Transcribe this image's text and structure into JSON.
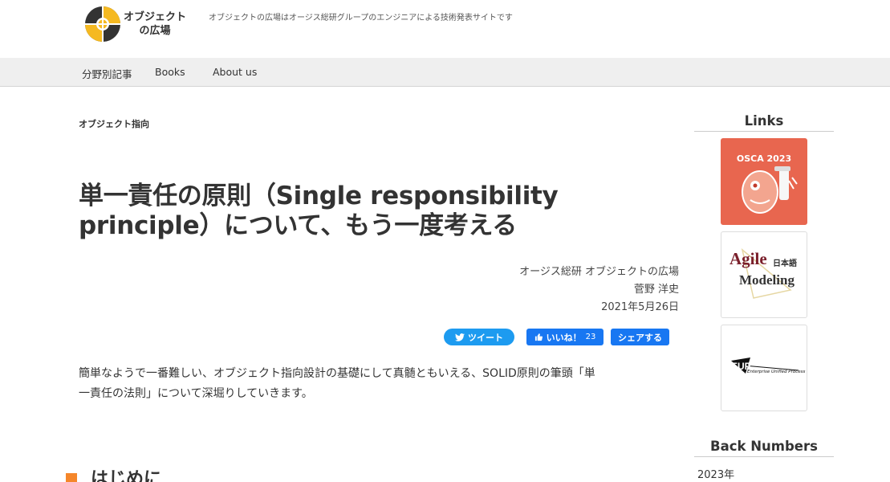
{
  "header": {
    "logo_line1": "オブジェクト",
    "logo_line2": "の広場",
    "tagline": "オブジェクトの広場はオージス総研グループのエンジニアによる技術発表サイトです"
  },
  "nav": {
    "items": [
      "分野別記事",
      "Books",
      "About us"
    ]
  },
  "article": {
    "category": "オブジェクト指向",
    "title_line1": "単一責任の原則（Single responsibility",
    "title_line2": "principle）について、もう一度考える",
    "byline_org": "オージス総研 オブジェクトの広場",
    "byline_author": "菅野 洋史",
    "byline_date": "2021年5月26日",
    "lead_line1": "簡単なようで一番難しい、オブジェクト指向設計の基礎にして真髄ともいえる、SOLID原則の筆頭「単",
    "lead_line2": "一責任の法則」について深堀りしていきます。",
    "section1_title": "はじめに"
  },
  "share": {
    "tweet_label": "ツイート",
    "like_label": "いいね！",
    "like_count": "23",
    "share_label": "シェアする"
  },
  "sidebar": {
    "links_heading": "Links",
    "osca_label": "OSCA 2023",
    "agile_label_a": "Agile",
    "agile_label_b": "Modeling",
    "agile_label_jp": "日本語",
    "eup_label": "EUP",
    "eup_sub": "Enterprise Unified Process",
    "back_numbers_heading": "Back Numbers",
    "years": [
      "2023年"
    ]
  },
  "colors": {
    "accent_orange": "#f5862a",
    "twitter_blue": "#1d9bf0",
    "facebook_blue": "#1877f2",
    "osca_red": "#e8664f",
    "logo_yellow": "#f5b921"
  }
}
